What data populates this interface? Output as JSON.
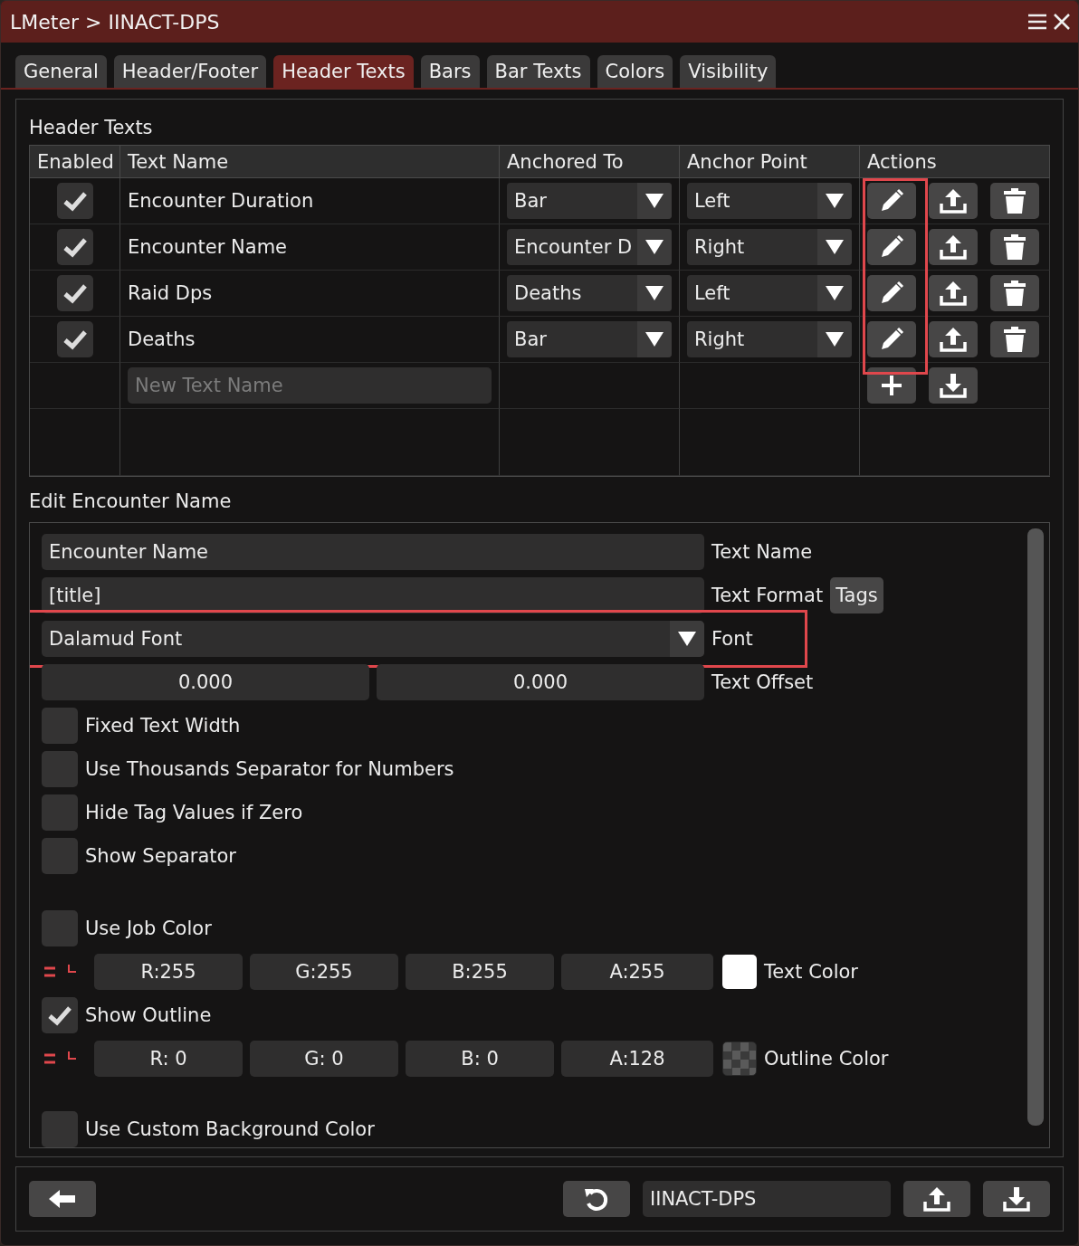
{
  "window": {
    "title": "LMeter > IINACT-DPS"
  },
  "tabs": [
    {
      "label": "General",
      "selected": false
    },
    {
      "label": "Header/Footer",
      "selected": false
    },
    {
      "label": "Header Texts",
      "selected": true
    },
    {
      "label": "Bars",
      "selected": false
    },
    {
      "label": "Bar Texts",
      "selected": false
    },
    {
      "label": "Colors",
      "selected": false
    },
    {
      "label": "Visibility",
      "selected": false
    }
  ],
  "header_texts": {
    "title": "Header Texts",
    "columns": [
      "Enabled",
      "Text Name",
      "Anchored To",
      "Anchor Point",
      "Actions"
    ],
    "rows": [
      {
        "enabled": true,
        "name": "Encounter Duration",
        "anchored_to": "Bar",
        "anchor_point": "Left"
      },
      {
        "enabled": true,
        "name": "Encounter Name",
        "anchored_to": "Encounter D",
        "anchor_point": "Right"
      },
      {
        "enabled": true,
        "name": "Raid Dps",
        "anchored_to": "Deaths",
        "anchor_point": "Left"
      },
      {
        "enabled": true,
        "name": "Deaths",
        "anchored_to": "Bar",
        "anchor_point": "Right"
      }
    ],
    "new_name_placeholder": "New Text Name"
  },
  "edit": {
    "title": "Edit Encounter Name",
    "text_name": {
      "value": "Encounter Name",
      "label": "Text Name"
    },
    "text_format": {
      "value": "[title]",
      "label": "Text Format",
      "button": "Tags"
    },
    "font": {
      "value": "Dalamud Font",
      "label": "Font"
    },
    "text_offset": {
      "values": [
        "0.000",
        "0.000"
      ],
      "label": "Text Offset"
    },
    "options": [
      {
        "label": "Fixed Text Width",
        "checked": false
      },
      {
        "label": "Use Thousands Separator for Numbers",
        "checked": false
      },
      {
        "label": "Hide Tag Values if Zero",
        "checked": false
      },
      {
        "label": "Show Separator",
        "checked": false
      }
    ],
    "job_color": {
      "label": "Use Job Color",
      "checked": false
    },
    "text_color": {
      "channels": [
        "R:255",
        "G:255",
        "B:255",
        "A:255"
      ],
      "swatch": {
        "kind": "solid",
        "color": "#ffffff"
      },
      "label": "Text Color"
    },
    "show_outline": {
      "label": "Show Outline",
      "checked": true
    },
    "outline_color": {
      "channels": [
        "R: 0",
        "G: 0",
        "B: 0",
        "A:128"
      ],
      "swatch": {
        "kind": "checker"
      },
      "label": "Outline Color"
    },
    "custom_background": {
      "label": "Use Custom Background Color",
      "checked": false
    }
  },
  "footer": {
    "profile_name": "IINACT-DPS"
  }
}
